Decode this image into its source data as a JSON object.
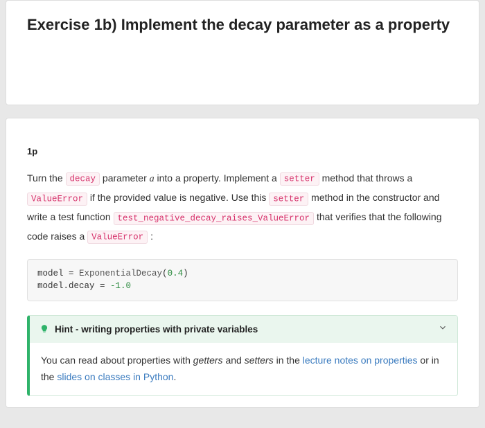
{
  "header": {
    "title": "Exercise 1b) Implement the decay parameter as a property"
  },
  "body": {
    "points": "1p",
    "p1a": "Turn the ",
    "code_decay": "decay",
    "p1b": " parameter ",
    "var_a": "a",
    "p1c": " into a property. Implement a ",
    "code_setter1": "setter",
    "p1d": " method that throws a ",
    "code_valueerror1": "ValueError",
    "p1e": " if the provided value is negative. Use this ",
    "code_setter2": "setter",
    "p1f": " method in the constructor and write a test function ",
    "code_testfn": "test_negative_decay_raises_ValueError",
    "p1g": " that verifies that the following code raises a ",
    "code_valueerror2": "ValueError",
    "p1h": " :"
  },
  "code": {
    "line1a": "model = ",
    "line1b": "ExponentialDecay",
    "line1c": "(",
    "line1d": "0.4",
    "line1e": ")",
    "line2a": "model.decay = ",
    "line2b": "-1.0"
  },
  "hint": {
    "title": "Hint - writing properties with private variables",
    "b1": "You can read about properties with ",
    "g": "getters",
    "b2": " and ",
    "s": "setters",
    "b3": " in the ",
    "link1": "lecture notes on properties",
    "b4": " or in the ",
    "link2": "slides on classes in Python",
    "b5": "."
  }
}
